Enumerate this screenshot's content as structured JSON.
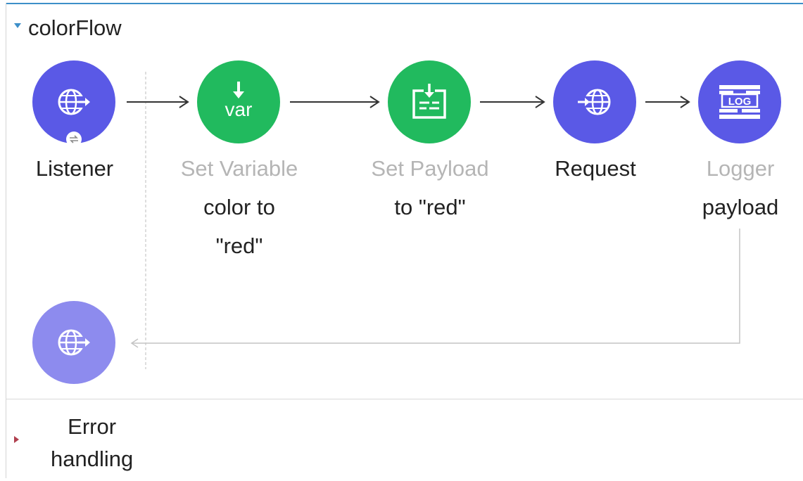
{
  "flow": {
    "name": "colorFlow",
    "expanded": true
  },
  "nodes": [
    {
      "id": "listener",
      "type": "http-listener",
      "lines": [
        "Listener"
      ],
      "style": "active"
    },
    {
      "id": "set-variable",
      "type": "set-variable",
      "icon_text": "var",
      "lines": [
        "Set Variable",
        "color to",
        "\"red\""
      ],
      "style": "mixed"
    },
    {
      "id": "set-payload",
      "type": "set-payload",
      "lines": [
        "Set Payload",
        "to \"red\""
      ],
      "style": "mixed"
    },
    {
      "id": "request",
      "type": "http-request",
      "lines": [
        "Request"
      ],
      "style": "active"
    },
    {
      "id": "logger",
      "type": "logger",
      "icon_text": "LOG",
      "lines": [
        "Logger",
        "payload"
      ],
      "style": "mixed"
    }
  ],
  "return_node": {
    "id": "listener-response",
    "type": "http-listener"
  },
  "error_handling": {
    "label_line1": "Error",
    "label_line2": "handling",
    "expanded": false
  },
  "colors": {
    "accent": "#3d8fc9",
    "http": "#5a59e6",
    "transform": "#21ba5e",
    "response": "#8d8bee",
    "error_toggle": "#b0404f"
  }
}
